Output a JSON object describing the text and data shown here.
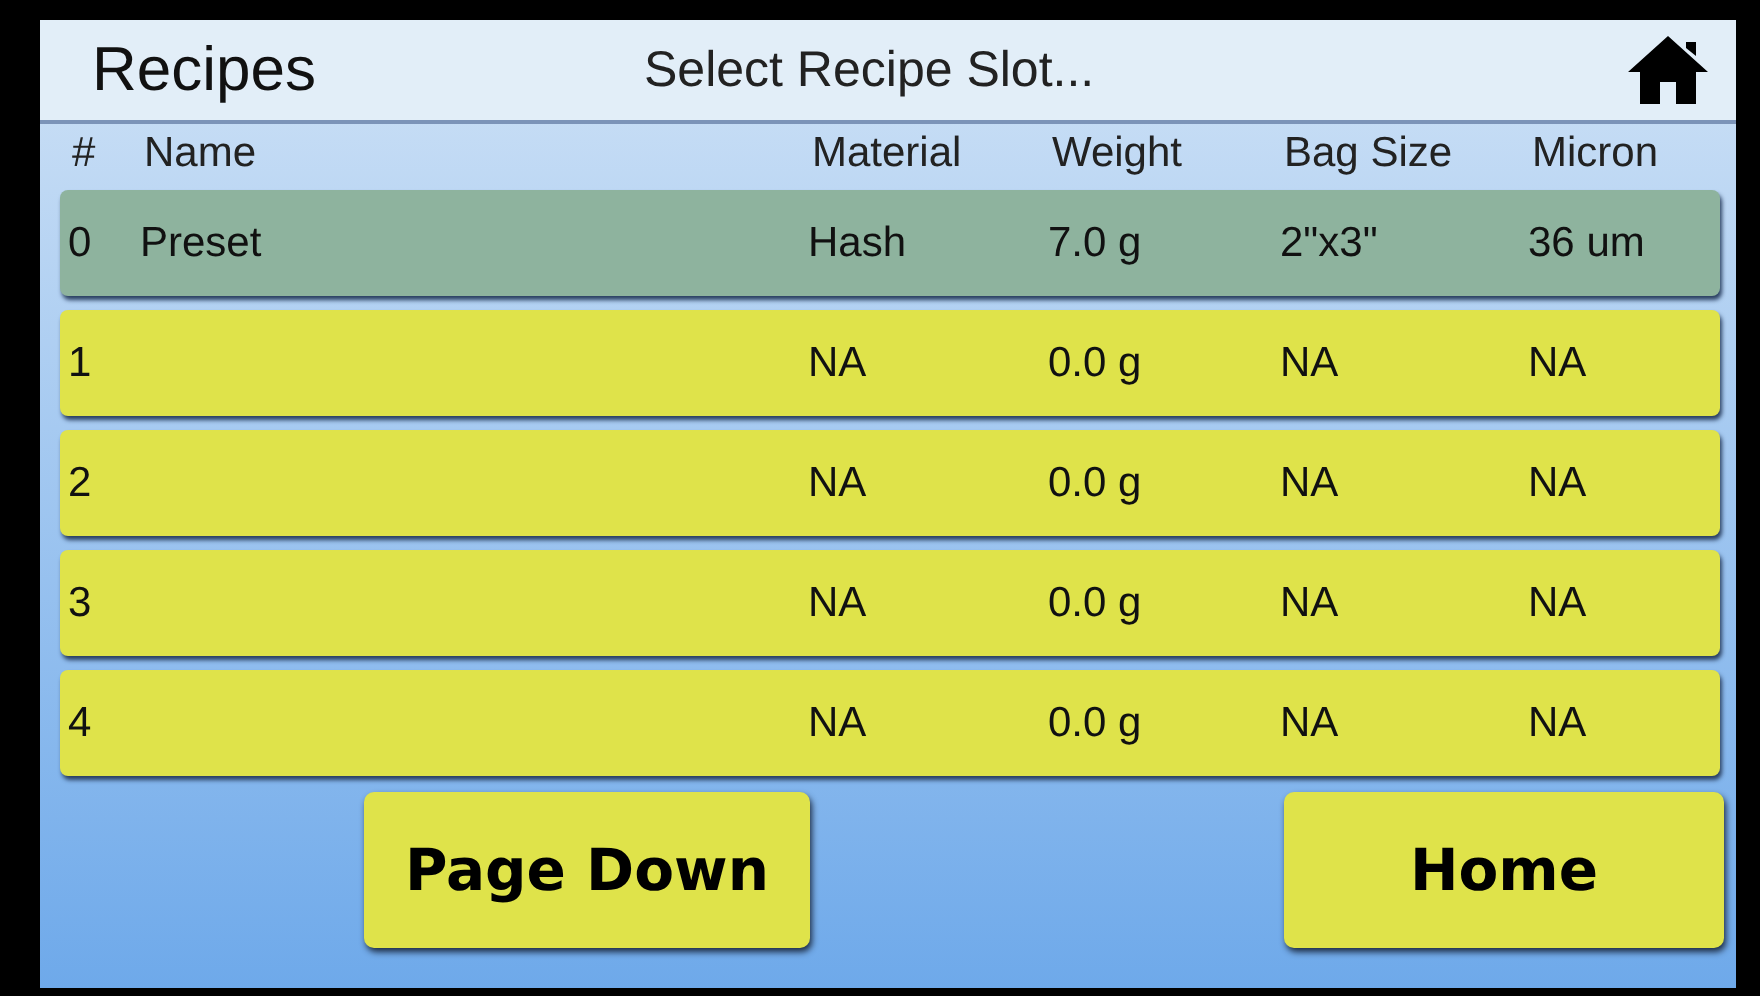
{
  "header": {
    "title": "Recipes",
    "subtitle": "Select Recipe Slot..."
  },
  "table": {
    "columns": [
      "#",
      "Name",
      "Material",
      "Weight",
      "Bag Size",
      "Micron"
    ],
    "rows": [
      {
        "cells": [
          "0",
          "Preset",
          "Hash",
          "7.0 g",
          "2\"x3\"",
          "36 um"
        ],
        "selected": true
      },
      {
        "cells": [
          "1",
          "",
          "NA",
          "0.0 g",
          "NA",
          "NA"
        ],
        "selected": false
      },
      {
        "cells": [
          "2",
          "",
          "NA",
          "0.0 g",
          "NA",
          "NA"
        ],
        "selected": false
      },
      {
        "cells": [
          "3",
          "",
          "NA",
          "0.0 g",
          "NA",
          "NA"
        ],
        "selected": false
      },
      {
        "cells": [
          "4",
          "",
          "NA",
          "0.0 g",
          "NA",
          "NA"
        ],
        "selected": false
      }
    ]
  },
  "buttons": [
    "Page Down",
    "Home"
  ]
}
